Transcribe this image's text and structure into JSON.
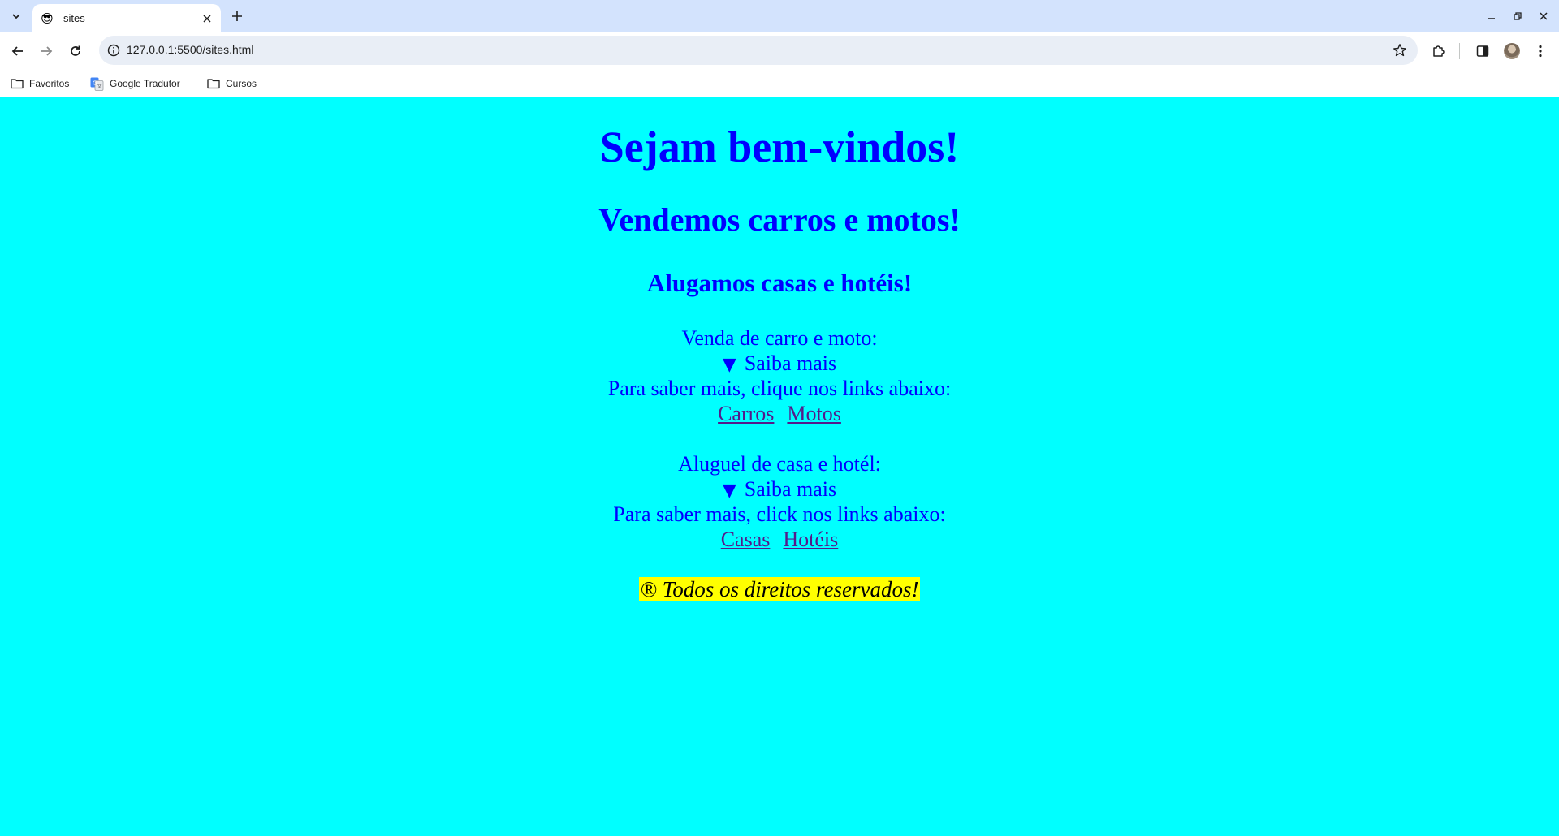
{
  "browser": {
    "tab": {
      "favicon": "😎",
      "title": "sites"
    },
    "url": "127.0.0.1:5500/sites.html",
    "bookmarks": [
      {
        "label": "Favoritos",
        "icon": "folder-icon"
      },
      {
        "label": "Google Tradutor",
        "icon": "google-translate-icon"
      },
      {
        "label": "Cursos",
        "icon": "folder-icon"
      }
    ]
  },
  "page": {
    "heading1": "Sejam bem-vindos!",
    "heading2": "Vendemos carros e motos!",
    "heading3": "Alugamos casas e hotéis!",
    "section1": {
      "title": "Venda de carro e moto:",
      "summary_arrow": "▼",
      "summary": "Saiba mais",
      "text": "Para saber mais, clique nos links abaixo:",
      "links": [
        "Carros",
        "Motos"
      ]
    },
    "section2": {
      "title": "Aluguel de casa e hotél:",
      "summary_arrow": "▼",
      "summary": "Saiba mais",
      "text": "Para saber mais, click nos links abaixo:",
      "links": [
        "Casas",
        "Hotéis"
      ]
    },
    "footer": "® Todos os direitos reservados!"
  },
  "colors": {
    "background": "#00ffff",
    "text": "#0000ff",
    "link": "#551a8b",
    "highlight": "#ffff00"
  }
}
